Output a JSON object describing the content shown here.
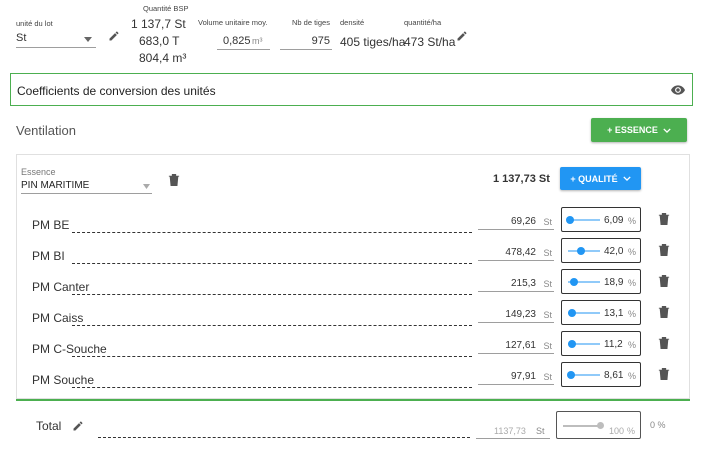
{
  "header": {
    "lot_unit_label": "unité du lot",
    "lot_unit_value": "St",
    "qty_bsp_label": "Quantité BSP",
    "qty_bsp_values": [
      "1 137,7 St",
      "683,0 T",
      "804,4 m³"
    ],
    "vol_label": "Volume unitaire moy.",
    "vol_value": "0,825",
    "vol_unit": "m³",
    "stems_label": "Nb de tiges",
    "stems_value": "975",
    "density_label": "densité",
    "density_value": "405 tiges/ha",
    "qty_ha_label": "quantité/ha",
    "qty_ha_value": "473 St/ha"
  },
  "coefficients": {
    "title": "Coefficients de conversion des unités"
  },
  "ventilation": {
    "title": "Ventilation",
    "add_essence_label": "+ ESSENCE"
  },
  "essence": {
    "label": "Essence",
    "value": "PIN MARITIME",
    "total": "1 137,73 St",
    "add_quality_label": "+ QUALITÉ",
    "unit": "St",
    "pct_unit": "%",
    "rows": [
      {
        "name": "PM BE",
        "value": "69,26",
        "pct": "6,09",
        "pct_num": 6.09
      },
      {
        "name": "PM BI",
        "value": "478,42",
        "pct": "42,0",
        "pct_num": 42.0
      },
      {
        "name": "PM Canter",
        "value": "215,3",
        "pct": "18,9",
        "pct_num": 18.9
      },
      {
        "name": "PM Caiss",
        "value": "149,23",
        "pct": "13,1",
        "pct_num": 13.1
      },
      {
        "name": "PM C-Souche",
        "value": "127,61",
        "pct": "11,2",
        "pct_num": 11.2
      },
      {
        "name": "PM Souche",
        "value": "97,91",
        "pct": "8,61",
        "pct_num": 8.61
      }
    ]
  },
  "total": {
    "label": "Total",
    "value": "1137,73",
    "unit": "St",
    "pct": "100",
    "pct_unit": "%",
    "pct_num": 100,
    "remaining": "0 %"
  },
  "colors": {
    "green": "#4caf50",
    "blue": "#2196f3"
  },
  "icons": [
    "pencil-icon",
    "eye-icon",
    "trash-icon",
    "chevron-down-icon",
    "dropdown-arrow-icon"
  ]
}
